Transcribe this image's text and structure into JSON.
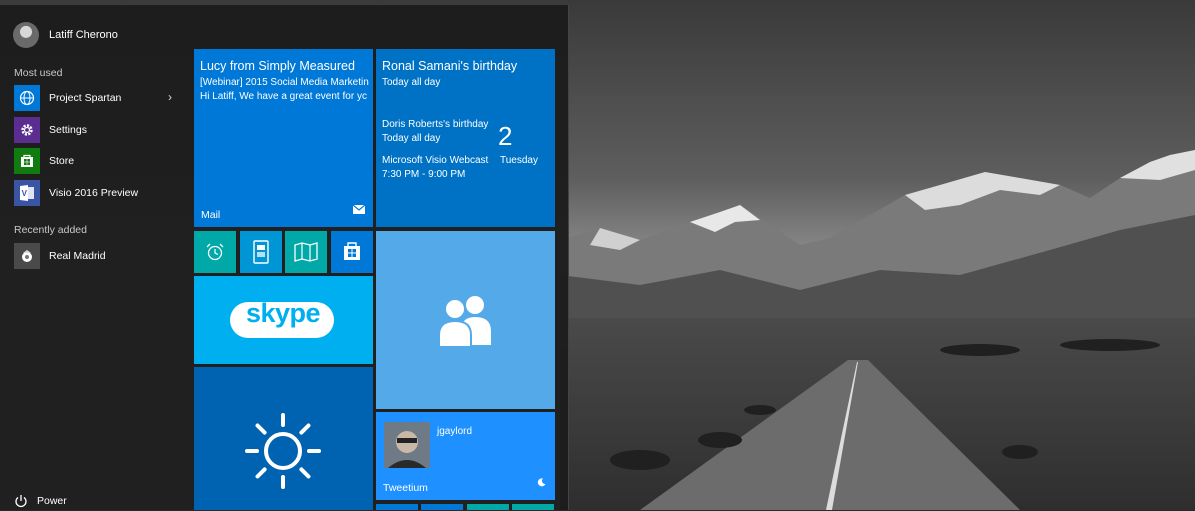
{
  "user": {
    "name": "Latiff Cherono"
  },
  "sections": {
    "most_used": "Most used",
    "recently_added": "Recently added"
  },
  "apps": [
    {
      "label": "Project Spartan",
      "icon": "globe-icon",
      "color": "#0078d7"
    },
    {
      "label": "Settings",
      "icon": "gear-icon",
      "color": "#5c2d91"
    },
    {
      "label": "Store",
      "icon": "store-icon",
      "color": "#107c10"
    },
    {
      "label": "Visio 2016 Preview",
      "icon": "visio-icon",
      "color": "#3955a3"
    }
  ],
  "recent": [
    {
      "label": "Real Madrid",
      "icon": "real-madrid-icon"
    }
  ],
  "power": {
    "label": "Power"
  },
  "tiles": {
    "mail": {
      "sender": "Lucy from Simply Measured",
      "subject": "[Webinar] 2015 Social Media Marketin",
      "preview": "Hi Latiff, We have a great event for yc",
      "label": "Mail",
      "color": "#0078d7"
    },
    "calendar": {
      "event1_title": "Ronal Samani's birthday",
      "event1_time": "Today all day",
      "event2_title": "Doris Roberts's birthday",
      "event2_time": "Today all day",
      "event3_title": "Microsoft Visio Webcast",
      "event3_time": "7:30 PM - 9:00 PM",
      "day_number": "2",
      "day_name": "Tuesday",
      "color": "#0072c6"
    },
    "small_tiles": [
      {
        "name": "alarm-tile",
        "icon": "alarm-clock-icon",
        "color": "#00a8a8"
      },
      {
        "name": "phone-tile",
        "icon": "phone-icon",
        "color": "#0096d6"
      },
      {
        "name": "maps-tile",
        "icon": "map-icon",
        "color": "#00a8a8"
      },
      {
        "name": "store-tile",
        "icon": "store-icon",
        "color": "#0078d7"
      }
    ],
    "skype": {
      "logo_text": "skype",
      "color": "#00aff0"
    },
    "people": {
      "icon": "people-icon",
      "color": "#54a9e8"
    },
    "weather": {
      "icon": "sun-icon",
      "color": "#0063b1"
    },
    "tweetium": {
      "user": "jgaylord",
      "label": "Tweetium",
      "color": "#1e90ff"
    }
  }
}
